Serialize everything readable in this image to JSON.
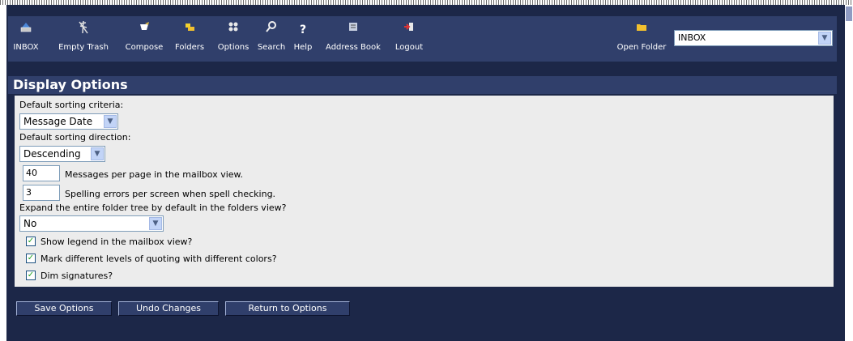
{
  "toolbar": {
    "items": [
      {
        "label": "INBOX",
        "icon": "inbox-icon"
      },
      {
        "label": "Empty Trash",
        "icon": "trash-icon"
      },
      {
        "label": "Compose",
        "icon": "compose-icon"
      },
      {
        "label": "Folders",
        "icon": "folders-icon"
      },
      {
        "label": "Options",
        "icon": "options-icon"
      },
      {
        "label": "Search",
        "icon": "search-icon"
      },
      {
        "label": "Help",
        "icon": "help-icon"
      },
      {
        "label": "Address Book",
        "icon": "address-book-icon"
      },
      {
        "label": "Logout",
        "icon": "logout-icon"
      }
    ],
    "open_folder_label": "Open Folder",
    "folder_value": "INBOX"
  },
  "section": {
    "title": "Display Options"
  },
  "options": {
    "sort_criteria_label": "Default sorting criteria:",
    "sort_criteria_value": "Message Date",
    "sort_direction_label": "Default sorting direction:",
    "sort_direction_value": "Descending",
    "messages_per_page_value": "40",
    "messages_per_page_label": "Messages per page in the mailbox view.",
    "spelling_errors_value": "3",
    "spelling_errors_label": "Spelling errors per screen when spell checking.",
    "expand_tree_label": "Expand the entire folder tree by default in the folders view?",
    "expand_tree_value": "No",
    "show_legend_label": "Show legend in the mailbox view?",
    "quoting_colors_label": "Mark different levels of quoting with different colors?",
    "dim_signatures_label": "Dim signatures?"
  },
  "buttons": {
    "save": "Save Options",
    "undo": "Undo Changes",
    "return": "Return to Options"
  },
  "colors": {
    "frame_bg": "#1c2748",
    "bar_bg": "#303f6b",
    "panel_bg": "#ececec",
    "check_color": "#21a121"
  }
}
